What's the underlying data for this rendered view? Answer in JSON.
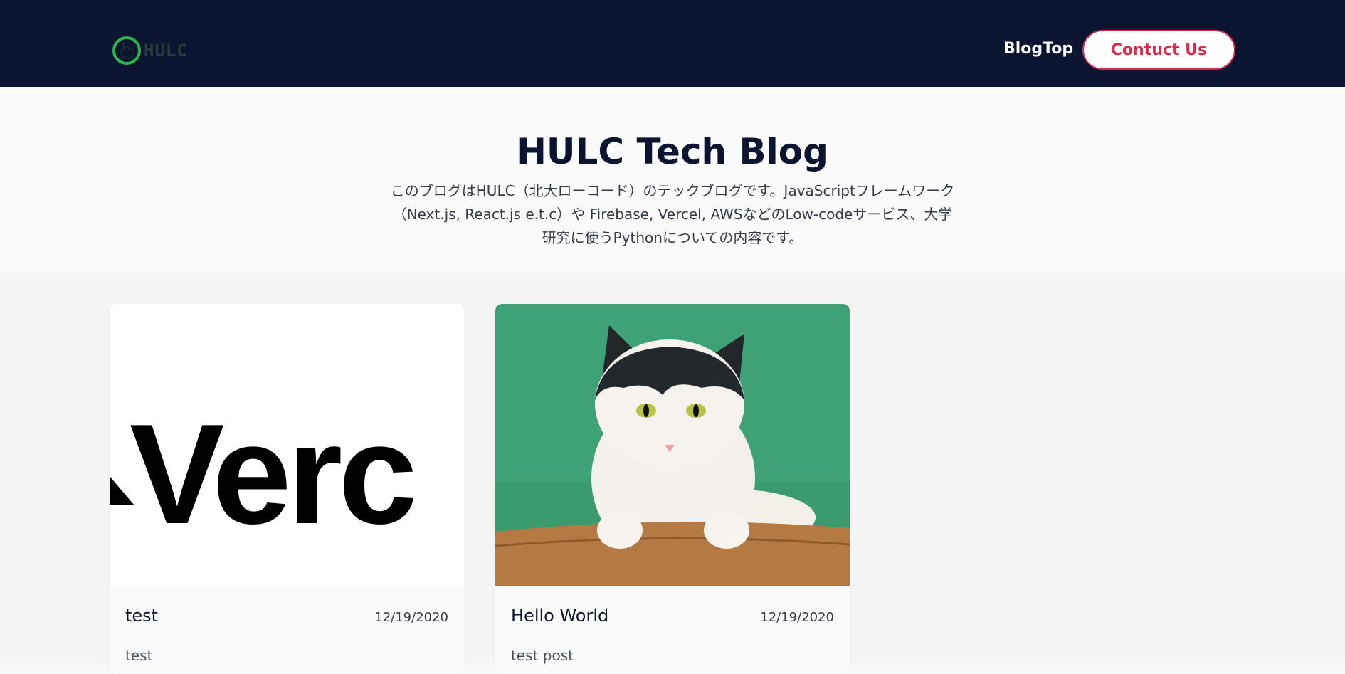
{
  "header": {
    "logo_text": "HULC",
    "nav_link": "BlogTop",
    "contact_button": "Contuct Us",
    "accent_color": "#e0294a",
    "logo_color": "#2fb34f",
    "bg_color": "#0b1430"
  },
  "hero": {
    "title": "HULC Tech Blog",
    "description": "このブログはHULC（北大ローコード）のテックブログです。JavaScriptフレームワーク（Next.js, React.js e.t.c）や Firebase, Vercel, AWSなどのLow-codeサービス、大学研究に使うPythonについての内容です。"
  },
  "posts": [
    {
      "image": "vercel-logo",
      "image_text": "Verc",
      "title": "test",
      "date": "12/19/2020",
      "excerpt": "test"
    },
    {
      "image": "cat-photo",
      "title": "Hello World",
      "date": "12/19/2020",
      "excerpt": "test post"
    }
  ]
}
